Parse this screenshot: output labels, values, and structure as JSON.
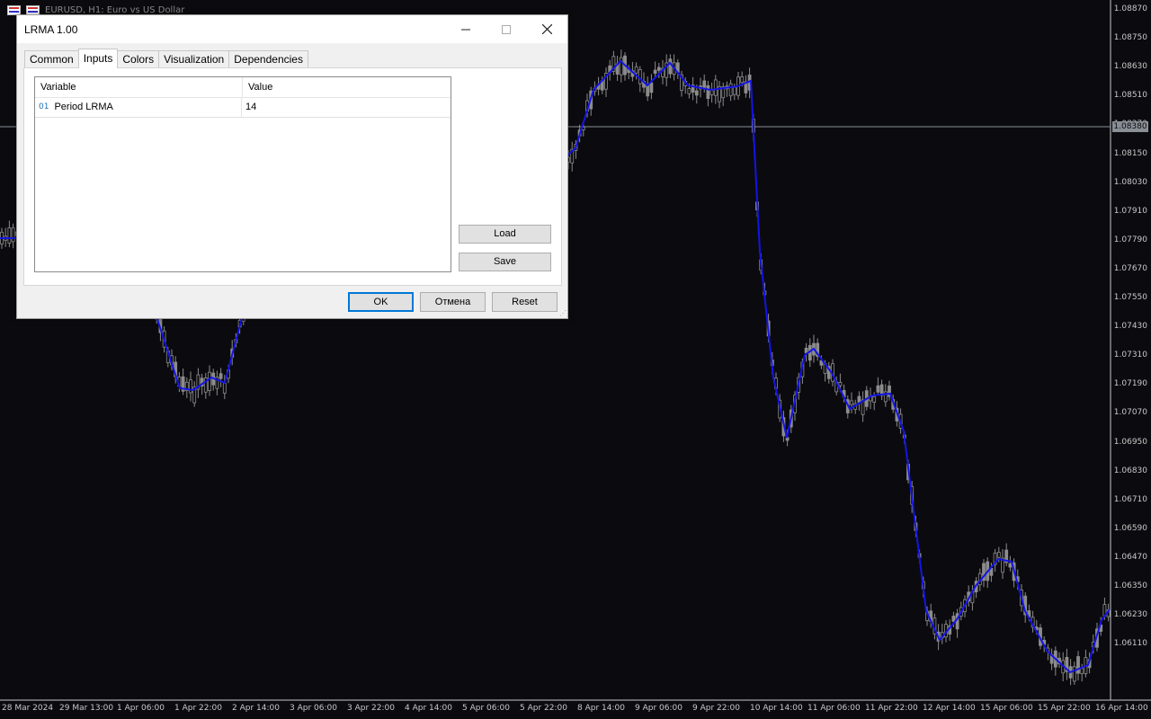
{
  "chart": {
    "symbol_header": "EURUSD, H1:  Euro vs US Dollar",
    "current_price": "1.08380",
    "price_labels": [
      "1.08870",
      "1.08750",
      "1.08630",
      "1.08510",
      "1.08270",
      "1.08150",
      "1.08030",
      "1.07910",
      "1.07790",
      "1.07670",
      "1.07550",
      "1.07430",
      "1.07310",
      "1.07190",
      "1.07070",
      "1.06950",
      "1.06830",
      "1.06710",
      "1.06590",
      "1.06470",
      "1.06350",
      "1.06230",
      "1.06110"
    ],
    "time_labels": [
      "28 Mar 2024",
      "29 Mar 13:00",
      "1 Apr 06:00",
      "1 Apr 22:00",
      "2 Apr 14:00",
      "3 Apr 06:00",
      "3 Apr 22:00",
      "4 Apr 14:00",
      "5 Apr 06:00",
      "5 Apr 22:00",
      "8 Apr 14:00",
      "9 Apr 06:00",
      "9 Apr 22:00",
      "10 Apr 14:00",
      "11 Apr 06:00",
      "11 Apr 22:00",
      "12 Apr 14:00",
      "15 Apr 06:00",
      "15 Apr 22:00",
      "16 Apr 14:00"
    ],
    "colors": {
      "background": "#0b0b0f",
      "candles": "#8c8c8c",
      "indicator": "#1414e6",
      "grid": "#c8c8c8"
    }
  },
  "dialog": {
    "title": "LRMA 1.00",
    "tabs": [
      {
        "label": "Common"
      },
      {
        "label": "Inputs",
        "active": true
      },
      {
        "label": "Colors"
      },
      {
        "label": "Visualization"
      },
      {
        "label": "Dependencies"
      }
    ],
    "grid": {
      "headers": {
        "variable": "Variable",
        "value": "Value"
      },
      "rows": [
        {
          "icon": "01",
          "variable": "Period LRMA",
          "value": "14"
        }
      ]
    },
    "buttons": {
      "load": "Load",
      "save": "Save",
      "ok": "OK",
      "cancel": "Отмена",
      "reset": "Reset"
    }
  }
}
